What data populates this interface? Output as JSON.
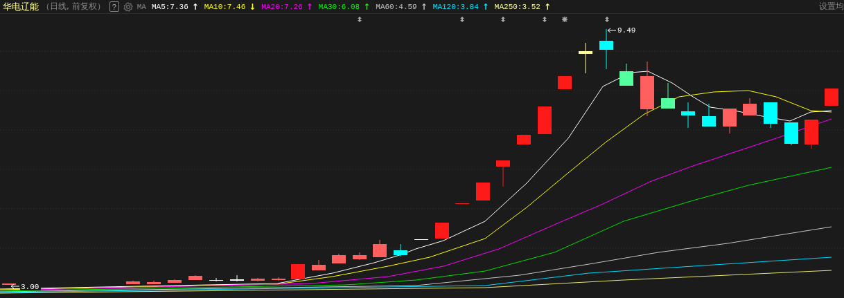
{
  "header": {
    "stock_name": "华电辽能",
    "period": "（日线, 前复权）",
    "help_button": "?",
    "indicator": "MA",
    "moving_averages": [
      {
        "label": "MA5:7.36",
        "color": "#ffffff",
        "arrow": "↑"
      },
      {
        "label": "MA10:7.46",
        "color": "#ffff00",
        "arrow": "↓"
      },
      {
        "label": "MA20:7.26",
        "color": "#ff00ff",
        "arrow": "↑"
      },
      {
        "label": "MA30:6.08",
        "color": "#00ff00",
        "arrow": "↑"
      },
      {
        "label": "MA60:4.59",
        "color": "#c0c0c0",
        "arrow": "↑"
      },
      {
        "label": "MA120:3.84",
        "color": "#00e5ff",
        "arrow": "↑"
      },
      {
        "label": "MA250:3.52",
        "color": "#ffff99",
        "arrow": "↑"
      }
    ],
    "settings_link": "设置均"
  },
  "chart": {
    "high_label": "9.49",
    "low_label": "3.00"
  }
}
